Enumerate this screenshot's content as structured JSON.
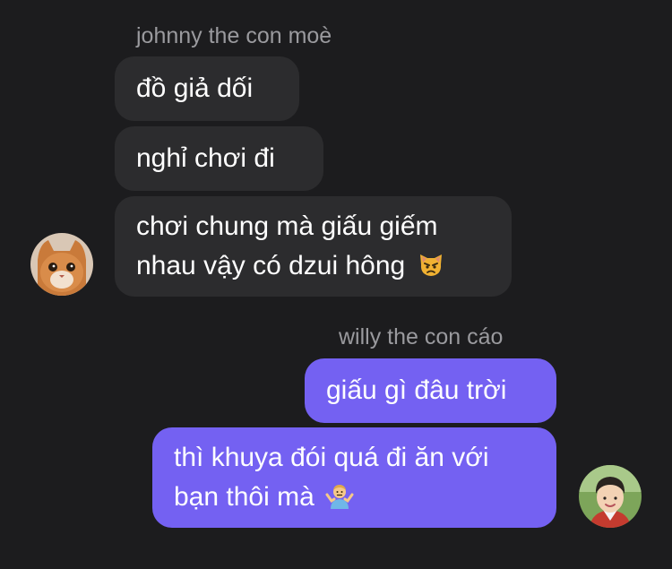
{
  "incoming": {
    "sender_name": "johnny the con moè",
    "messages": [
      {
        "text": "đồ giả dối"
      },
      {
        "text": "nghỉ chơi đi"
      },
      {
        "line1": "chơi chung mà giấu giếm",
        "line2": "nhau vậy có dzui hông",
        "emoji": "pouting-cat-emoji"
      }
    ],
    "avatar": "orange-cat-avatar"
  },
  "outgoing": {
    "sender_name": "willy the con cáo",
    "messages": [
      {
        "text": "giấu gì đâu trời"
      },
      {
        "line1": "thì khuya đói quá đi ăn với",
        "line2": "bạn thôi mà",
        "emoji": "person-shrugging-emoji"
      }
    ],
    "avatar": "child-photo-avatar"
  },
  "colors": {
    "background": "#1c1c1e",
    "incoming_bubble": "#2c2c2e",
    "outgoing_bubble": "#7461f2",
    "sender_name": "#9a9a9e",
    "text": "#ffffff"
  }
}
